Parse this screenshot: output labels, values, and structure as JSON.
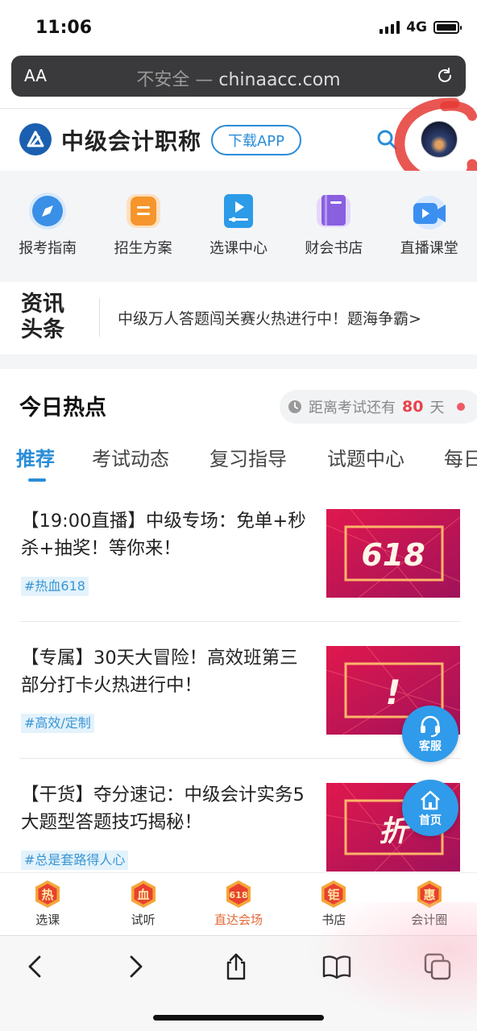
{
  "status_bar": {
    "time": "11:06",
    "network": "4G"
  },
  "browser": {
    "aa_label": "AA",
    "insecure_label": "不安全 —",
    "domain": "chinaacc.com"
  },
  "header": {
    "title": "中级会计职称",
    "download_button": "下载APP"
  },
  "icon_nav": [
    {
      "label": "报考指南",
      "icon": "compass-icon",
      "color": "#3a8fe6"
    },
    {
      "label": "招生方案",
      "icon": "document-list-icon",
      "color": "#f5952b"
    },
    {
      "label": "选课中心",
      "icon": "video-play-icon",
      "color": "#2c9be8"
    },
    {
      "label": "财会书店",
      "icon": "book-icon",
      "color": "#8a5fe0"
    },
    {
      "label": "直播课堂",
      "icon": "live-camera-icon",
      "color": "#3b8ff0"
    }
  ],
  "news": {
    "tag_line1": "资讯",
    "tag_line2": "头条",
    "headline": "中级万人答题闯关赛火热进行中！题海争霸>"
  },
  "hot": {
    "title": "今日热点",
    "countdown_prefix": "距离考试还有",
    "countdown_days": "80",
    "countdown_unit": "天"
  },
  "tabs": [
    {
      "label": "推荐",
      "active": true
    },
    {
      "label": "考试动态",
      "active": false
    },
    {
      "label": "复习指导",
      "active": false
    },
    {
      "label": "试题中心",
      "active": false
    },
    {
      "label": "每日",
      "active": false
    }
  ],
  "articles": [
    {
      "title": "【19:00直播】中级专场：免单+秒杀+抽奖！等你来！",
      "hashtag": "#热血618",
      "thumb_text": "618"
    },
    {
      "title": "【专属】30天大冒险！高效班第三部分打卡火热进行中！",
      "hashtag": "#高效/定制",
      "thumb_text": "!"
    },
    {
      "title": "【干货】夺分速记：中级会计实务5大题型答题技巧揭秘！",
      "hashtag": "#总是套路得人心",
      "thumb_text": "折"
    }
  ],
  "float_buttons": {
    "service": "客服",
    "home": "首页"
  },
  "tab_bar": [
    {
      "label": "选课",
      "badge": "热",
      "active": false
    },
    {
      "label": "试听",
      "badge": "血",
      "active": false
    },
    {
      "label": "直达会场",
      "badge": "618",
      "active": true
    },
    {
      "label": "书店",
      "badge": "钜",
      "active": false
    },
    {
      "label": "会计圈",
      "badge": "惠",
      "active": false
    }
  ],
  "colors": {
    "accent": "#2a8dd8",
    "badge_orange": "#f08a2c",
    "price_red": "#e8424b",
    "thumb_magenta": "#c2185b"
  }
}
